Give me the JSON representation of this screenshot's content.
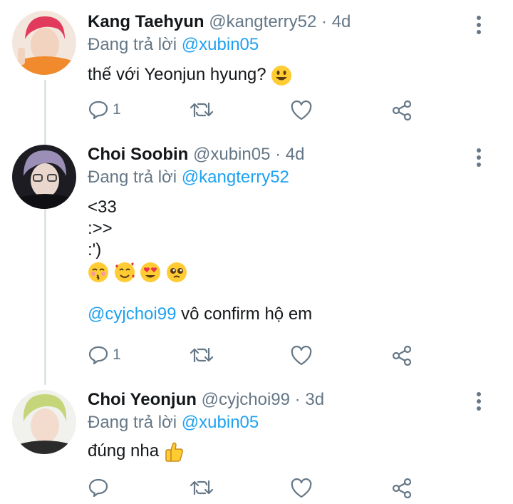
{
  "tweets": [
    {
      "name": "Kang Taehyun",
      "handle": "@kangterry52",
      "time": "4d",
      "replying_prefix": "Đang trả lời",
      "replying_to": "@xubin05",
      "text": "thế với Yeonjun hyung?",
      "reply_count": "1",
      "avatar_color": "#e94b6c"
    },
    {
      "name": "Choi Soobin",
      "handle": "@xubin05",
      "time": "4d",
      "replying_prefix": "Đang trả lời",
      "replying_to": "@kangterry52",
      "lines": [
        "<33",
        ":>>",
        ":')"
      ],
      "mention": "@cyjchoi99",
      "mention_text": "vô confirm hộ em",
      "reply_count": "1",
      "avatar_color": "#2b2b33"
    },
    {
      "name": "Choi Yeonjun",
      "handle": "@cyjchoi99",
      "time": "3d",
      "replying_prefix": "Đang trả lời",
      "replying_to": "@xubin05",
      "text": "đúng nha",
      "reply_count": "",
      "avatar_color": "#c9d88a"
    }
  ],
  "separator": "·",
  "colors": {
    "link": "#1da1f2",
    "muted": "#657786",
    "text": "#14171a"
  },
  "icons": [
    "reply-icon",
    "retweet-icon",
    "like-icon",
    "share-icon",
    "more-vertical-icon"
  ]
}
